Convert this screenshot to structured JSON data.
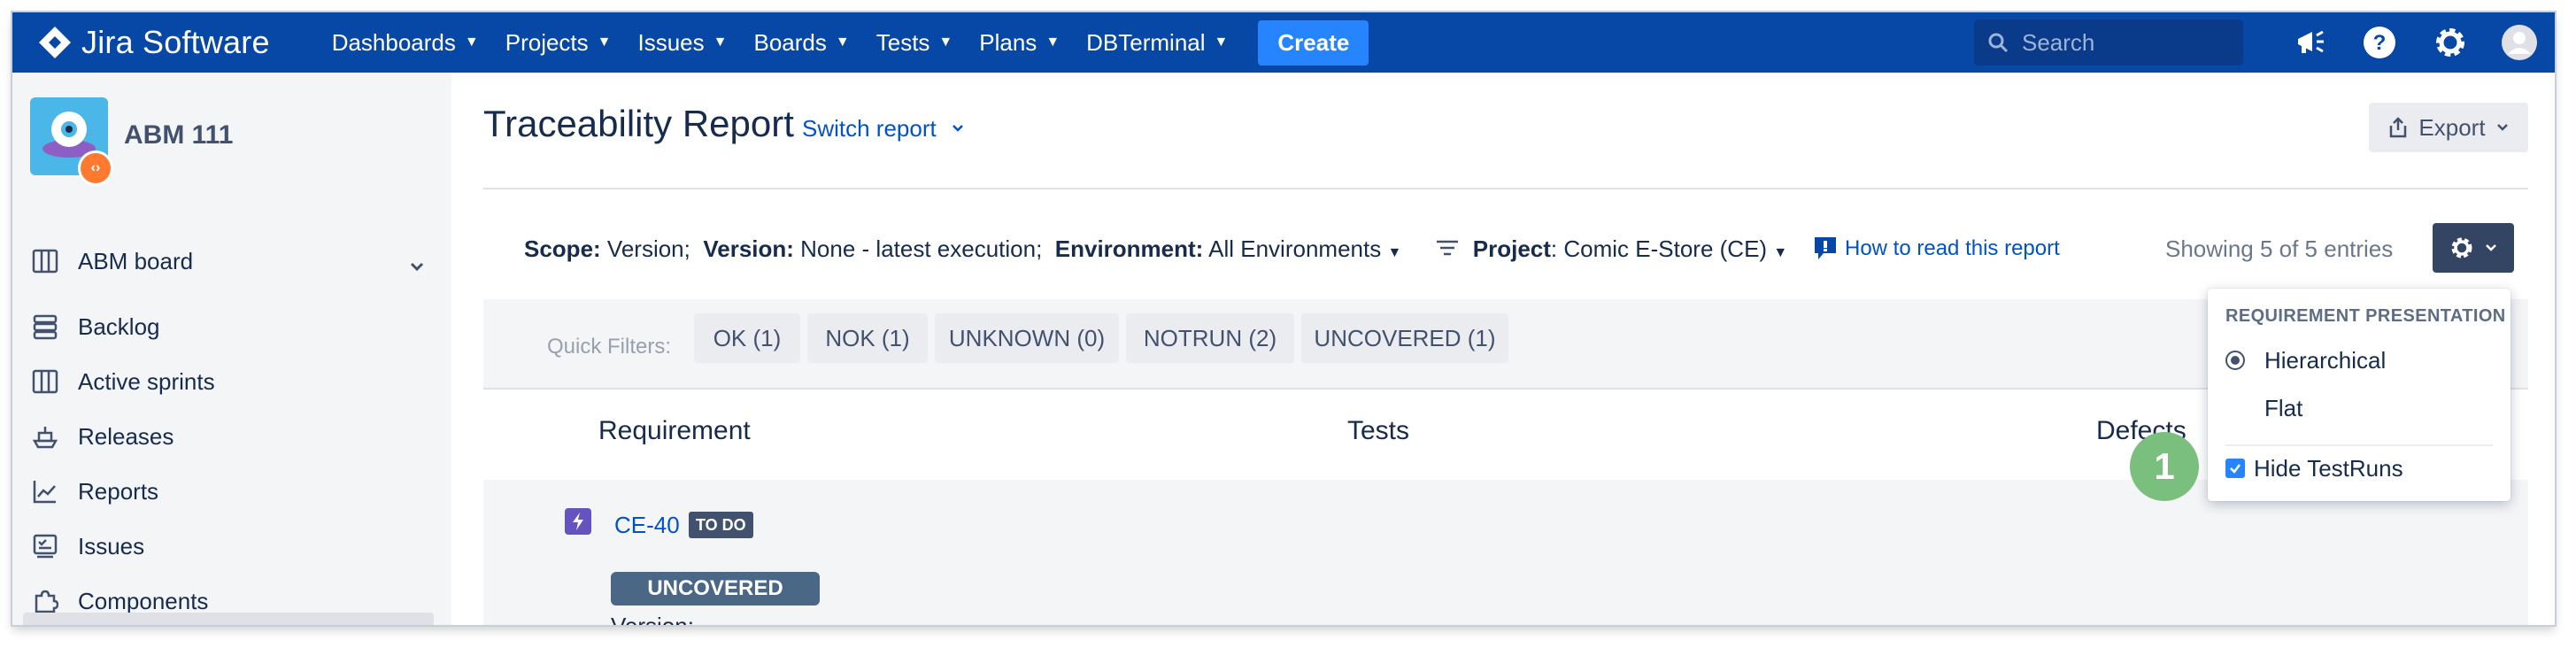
{
  "topnav": {
    "product_name": "Jira Software",
    "items": [
      {
        "label": "Dashboards"
      },
      {
        "label": "Projects"
      },
      {
        "label": "Issues"
      },
      {
        "label": "Boards"
      },
      {
        "label": "Tests"
      },
      {
        "label": "Plans"
      },
      {
        "label": "DBTerminal"
      }
    ],
    "create_label": "Create",
    "search_placeholder": "Search",
    "colors": {
      "background": "#0747a6",
      "create": "#2684ff"
    }
  },
  "sidebar": {
    "project_name": "ABM 111",
    "board_label": "ABM board",
    "items": [
      {
        "label": "Backlog",
        "icon": "backlog-icon"
      },
      {
        "label": "Active sprints",
        "icon": "board-icon"
      },
      {
        "label": "Releases",
        "icon": "ship-icon"
      },
      {
        "label": "Reports",
        "icon": "chart-icon"
      },
      {
        "label": "Issues",
        "icon": "issues-icon"
      },
      {
        "label": "Components",
        "icon": "puzzle-icon"
      }
    ]
  },
  "report": {
    "title": "Traceability Report",
    "switch_label": "Switch report",
    "export_label": "Export",
    "scope": {
      "scope_label": "Scope:",
      "scope_value": "Version;",
      "version_label": "Version:",
      "version_value": "None - latest execution;",
      "environment_label": "Environment:",
      "environment_value": "All Environments",
      "project_label": "Project",
      "project_value": ": Comic E-Store (CE)"
    },
    "how_to_label": "How to read this report",
    "showing_text": "Showing 5 of 5 entries",
    "quick_filters_label": "Quick Filters:",
    "quick_filters": [
      {
        "label": "OK (1)"
      },
      {
        "label": "NOK (1)"
      },
      {
        "label": "UNKNOWN (0)"
      },
      {
        "label": "NOTRUN (2)"
      },
      {
        "label": "UNCOVERED (1)"
      }
    ],
    "columns": {
      "requirement": "Requirement",
      "tests": "Tests",
      "defects": "Defects"
    },
    "rows": [
      {
        "key": "CE-40",
        "status": "TO DO",
        "coverage": "UNCOVERED",
        "version": "Version: -"
      }
    ]
  },
  "settings_menu": {
    "section_title": "REQUIREMENT PRESENTATION",
    "option_hierarchical": "Hierarchical",
    "option_flat": "Flat",
    "selected": "Hierarchical",
    "hide_testruns_label": "Hide TestRuns",
    "hide_testruns_checked": true
  },
  "callout": {
    "number": "1"
  }
}
